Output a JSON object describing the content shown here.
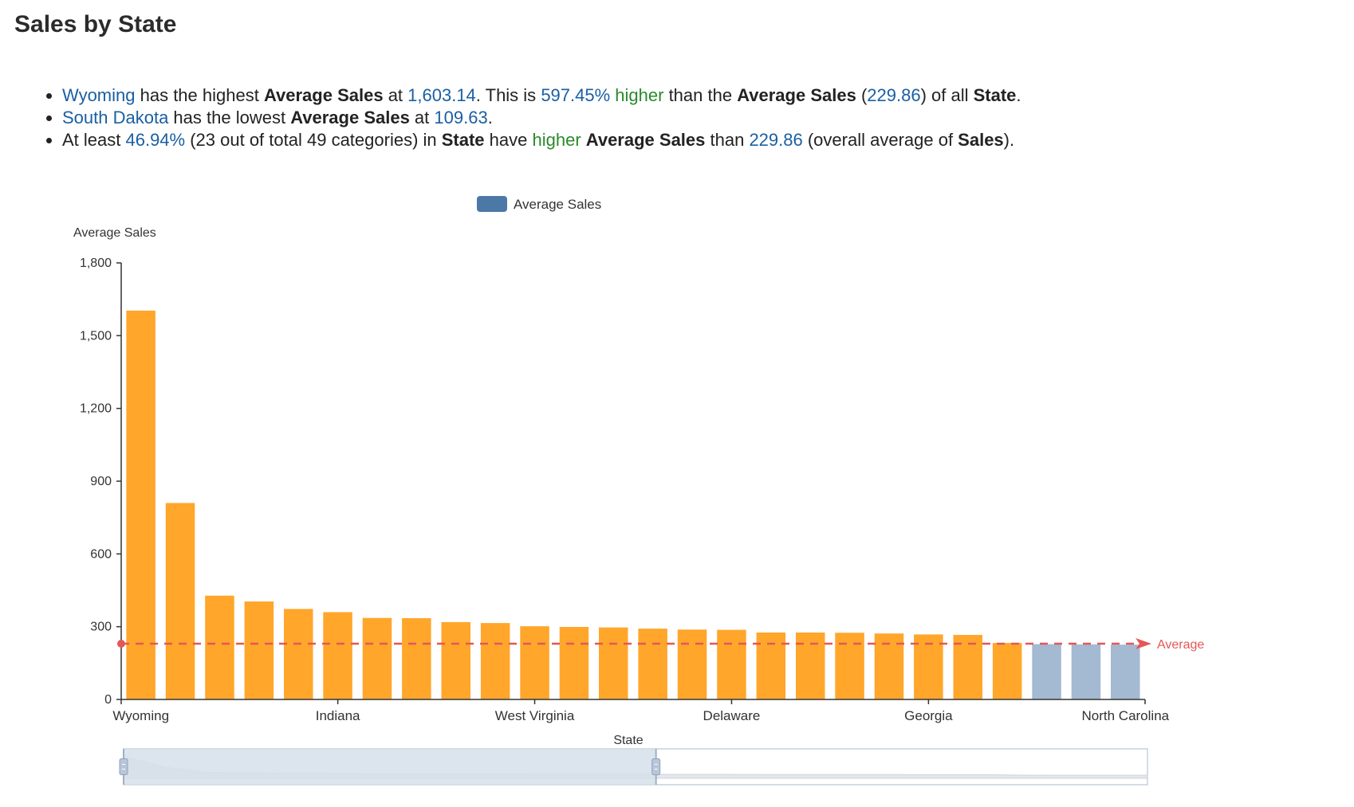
{
  "page": {
    "title": "Sales by State"
  },
  "insights": {
    "line1": {
      "state": "Wyoming",
      "t1": " has the highest ",
      "measure": "Average Sales",
      "t2": " at ",
      "value": "1,603.14",
      "t3": ". This is ",
      "pct": "597.45%",
      "t4": " ",
      "direction": "higher",
      "t5": " than the ",
      "measure2": "Average Sales",
      "t6": " (",
      "avg": "229.86",
      "t7": ") of all ",
      "dimension": "State",
      "t8": "."
    },
    "line2": {
      "state": "South Dakota",
      "t1": " has the lowest ",
      "measure": "Average Sales",
      "t2": " at ",
      "value": "109.63",
      "t3": "."
    },
    "line3": {
      "t1": "At least ",
      "pct": "46.94%",
      "t2": " (23 out of total 49 categories) in ",
      "dimension": "State",
      "t3": " have ",
      "direction": "higher",
      "t4": " ",
      "measure": "Average Sales",
      "t5": " than ",
      "avg": "229.86",
      "t6": " (overall average of ",
      "measure2": "Sales",
      "t7": ")."
    }
  },
  "colors": {
    "above_average": "#FFA62B",
    "below_average": "#A4B9D2",
    "legend_swatch": "#4C78A8",
    "average_line": "#E45756",
    "axis": "#333333",
    "highlight_text": "#1a5fa3",
    "positive_text": "#2a8a2a",
    "slider_fill": "#d6dfea",
    "slider_border": "#c5d0de"
  },
  "chart_data": {
    "type": "bar",
    "title": "",
    "xlabel": "State",
    "ylabel": "Average Sales",
    "ylim": [
      0,
      1800
    ],
    "yticks": [
      0,
      300,
      600,
      900,
      1200,
      1500,
      1800
    ],
    "ytick_labels": [
      "0",
      "300",
      "600",
      "900",
      "1,200",
      "1,500",
      "1,800"
    ],
    "categories": [
      "Wyoming",
      "",
      "",
      "",
      "",
      "Indiana",
      "",
      "",
      "",
      "",
      "West Virginia",
      "",
      "",
      "",
      "",
      "Delaware",
      "",
      "",
      "",
      "",
      "Georgia",
      "",
      "",
      "",
      "",
      "North Carolina"
    ],
    "tick_categories": [
      "Wyoming",
      "Indiana",
      "West Virginia",
      "Delaware",
      "Georgia",
      "North Carolina"
    ],
    "series": [
      {
        "name": "Average Sales",
        "values": [
          1603.14,
          810,
          428,
          404,
          373,
          360,
          336,
          335,
          319,
          315,
          302,
          299,
          297,
          292,
          288,
          287,
          276,
          276,
          275,
          272,
          268,
          266,
          233,
          228,
          227,
          226
        ]
      }
    ],
    "average": {
      "value": 229.86,
      "label": "Average"
    },
    "legend": {
      "position": "top",
      "entries": [
        "Average Sales"
      ]
    },
    "grid": false,
    "data_zoom": {
      "start_percent": 0,
      "end_percent": 52
    }
  }
}
